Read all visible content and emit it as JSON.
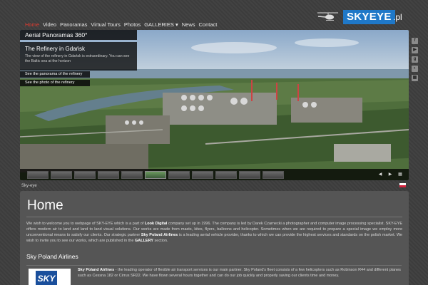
{
  "nav": {
    "items": [
      {
        "label": "Home",
        "active": true
      },
      {
        "label": "Video"
      },
      {
        "label": "Panoramas"
      },
      {
        "label": "Virtual Tours"
      },
      {
        "label": "Photos"
      },
      {
        "label": "GALLERIES ▾"
      },
      {
        "label": "News"
      },
      {
        "label": "Contact"
      }
    ]
  },
  "logo": {
    "brand": "SKYEYE",
    "tld": ".pl",
    "icon": "helicopter-icon"
  },
  "hero": {
    "title": "Aerial Panoramas 360°",
    "info_heading": "The Refinery in Gdańsk",
    "info_text": "The view of the refinery in Gdańsk is extraordinary. You can see the Baltic sea at the horizon",
    "btn_panorama": "See the panorama of the refinery",
    "btn_photo": "See the photo of the refinery",
    "thumbnail_count": 11,
    "active_thumbnail": 6
  },
  "social_icons": [
    "facebook-icon",
    "youtube-icon",
    "google-plus-icon",
    "panorama-icon",
    "grid-icon"
  ],
  "credit": "Sky-eye",
  "language_flag": "polish-flag-icon",
  "content": {
    "heading": "Home",
    "intro_parts": [
      "We wish to welcome you to webpage of SKY-EYE which is a part of ",
      "Look Digital",
      " company set up in 1996. The company is led by Darek Czarnecki a photographer and computer image processing specialist. SKY-EYE offers modern air to land and land to land visual solutions. Our works are made from masts, kites, flyers, balloons and helicopter. Sometimes when we are required to prepare a special image we employ more unconventional means to satisfy our clients. Our strategic partner ",
      "Sky Poland Airlines",
      " is a leading aerial vehicle provider, thanks to which we can provide the highest services and standards on the polish market. We wish to invite you to see our works, which are published in the ",
      "GALLERY",
      " section."
    ],
    "subheading": "Sky Poland Airlines",
    "partner_logo_text": "SKY",
    "partner_parts": [
      "Sky Poland Airlines",
      " - the leading operator of flexible air transport services is our main partner. Sky Poland's fleet consists of a few helicopters such as Robinson R44 and different planes such as Cessna 182 or Cirrus SR22. We have flown several hours together and can do our job quickly and properly saving our clients time and money."
    ]
  },
  "colors": {
    "accent_active": "#e03a2f",
    "brand_blue": "#1f78c8",
    "panel": "#555555",
    "background": "#3e3e3e"
  }
}
